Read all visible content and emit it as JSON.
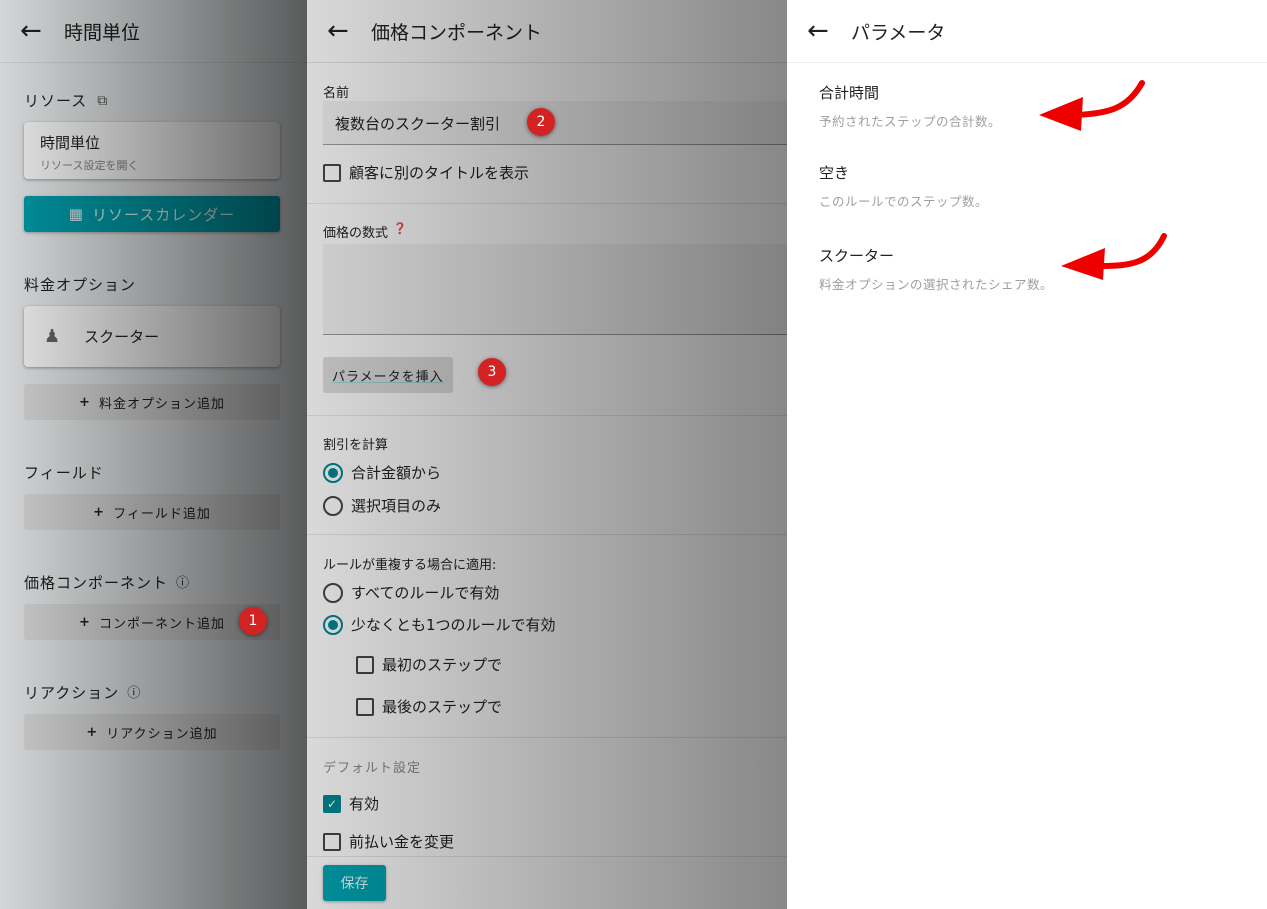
{
  "left": {
    "title": "時間単位",
    "resource_label": "リソース",
    "resource_card_title": "時間単位",
    "resource_card_sub": "リソース設定を開く",
    "calendar_button": "リソースカレンダー",
    "pricing_label": "料金オプション",
    "pricing_item": "スクーター",
    "add_pricing": "料金オプション追加",
    "fields_label": "フィールド",
    "add_field": "フィールド追加",
    "components_label": "価格コンポーネント",
    "add_component": "コンポーネント追加",
    "reactions_label": "リアクション",
    "add_reaction": "リアクション追加"
  },
  "mid": {
    "title": "価格コンポーネント",
    "name_label": "名前",
    "name_value": "複数台のスクーター割引",
    "alt_title_label": "顧客に別のタイトルを表示",
    "formula_label": "価格の数式",
    "formula_value": "",
    "insert_param": "パラメータを挿入",
    "calc_label": "割引を計算",
    "calc_options": [
      "合計金額から",
      "選択項目のみ"
    ],
    "overlap_label": "ルールが重複する場合に適用:",
    "overlap_options": [
      "すべてのルールで有効",
      "少なくとも1つのルールで有効"
    ],
    "first_step": "最初のステップで",
    "last_step": "最後のステップで",
    "defaults_label": "デフォルト設定",
    "enabled": "有効",
    "change_deposit": "前払い金を変更",
    "save": "保存"
  },
  "right": {
    "title": "パラメータ",
    "params": [
      {
        "name": "合計時間",
        "desc": "予約されたステップの合計数。"
      },
      {
        "name": "空き",
        "desc": "このルールでのステップ数。"
      },
      {
        "name": "スクーター",
        "desc": "料金オプションの選択されたシェア数。"
      }
    ]
  },
  "badges": [
    "1",
    "2",
    "3"
  ],
  "colors": {
    "accent": "#00838f",
    "badge": "#d32222",
    "arrow": "#ee0000"
  }
}
